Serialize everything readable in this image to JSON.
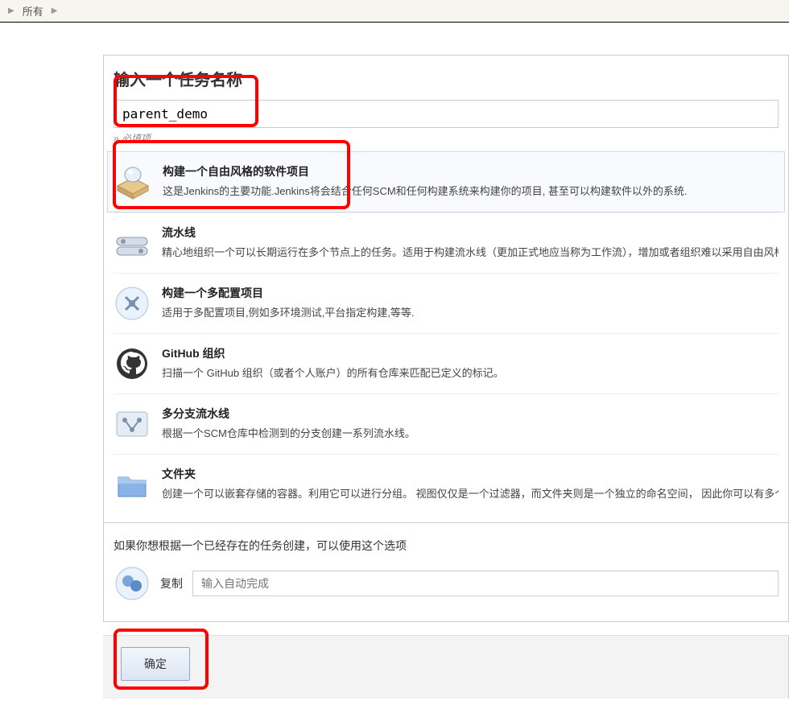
{
  "breadcrumb": {
    "item": "所有"
  },
  "name_section": {
    "title": "输入一个任务名称",
    "value": "parent_demo",
    "required": "» 必填项"
  },
  "options": [
    {
      "title": "构建一个自由风格的软件项目",
      "desc": "这是Jenkins的主要功能.Jenkins将会结合任何SCM和任何构建系统来构建你的项目, 甚至可以构建软件以外的系统.",
      "selected": true
    },
    {
      "title": "流水线",
      "desc": "精心地组织一个可以长期运行在多个节点上的任务。适用于构建流水线（更加正式地应当称为工作流），增加或者组织难以采用自由风格的任务类型。"
    },
    {
      "title": "构建一个多配置项目",
      "desc": "适用于多配置项目,例如多环境测试,平台指定构建,等等."
    },
    {
      "title": "GitHub 组织",
      "desc": "扫描一个 GitHub 组织（或者个人账户）的所有仓库来匹配已定义的标记。"
    },
    {
      "title": "多分支流水线",
      "desc": "根据一个SCM仓库中检测到的分支创建一系列流水线。"
    },
    {
      "title": "文件夹",
      "desc": "创建一个可以嵌套存储的容器。利用它可以进行分组。 视图仅仅是一个过滤器，而文件夹则是一个独立的命名空间， 因此你可以有多个相同名称的的内容，只要它们在不同的文件 夹里即可。"
    }
  ],
  "copy": {
    "hint": "如果你想根据一个已经存在的任务创建，可以使用这个选项",
    "label": "复制",
    "placeholder": "输入自动完成"
  },
  "footer": {
    "ok": "确定"
  }
}
